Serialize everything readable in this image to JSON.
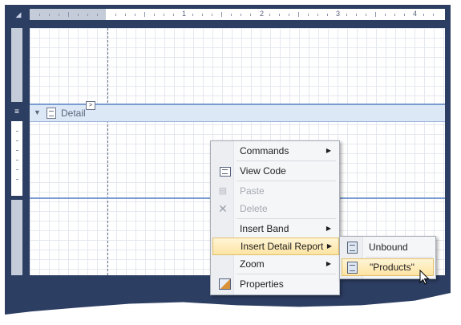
{
  "ruler": {
    "numbers": [
      "1",
      "2",
      "3",
      "4"
    ]
  },
  "band": {
    "label": "Detail",
    "smart_tag_glyph": ">"
  },
  "context_menu": {
    "items": [
      {
        "label": "Commands",
        "icon": "none",
        "submenu": true,
        "enabled": true
      },
      {
        "label": "View Code",
        "icon": "view-code-icon",
        "submenu": false,
        "enabled": true
      },
      {
        "label": "Paste",
        "icon": "paste-icon",
        "submenu": false,
        "enabled": false
      },
      {
        "label": "Delete",
        "icon": "delete-icon",
        "submenu": false,
        "enabled": false
      },
      {
        "label": "Insert Band",
        "icon": "none",
        "submenu": true,
        "enabled": true
      },
      {
        "label": "Insert Detail Report",
        "icon": "none",
        "submenu": true,
        "enabled": true,
        "highlighted": true
      },
      {
        "label": "Zoom",
        "icon": "none",
        "submenu": true,
        "enabled": true
      },
      {
        "label": "Properties",
        "icon": "properties-icon",
        "submenu": false,
        "enabled": true
      }
    ]
  },
  "submenu": {
    "items": [
      {
        "label": "Unbound",
        "icon": "report-icon"
      },
      {
        "label": "\"Products\"",
        "icon": "report-icon",
        "highlighted": true
      }
    ]
  },
  "colors": {
    "frame": "#2d3e63",
    "band_header": "#dde8f7",
    "highlight": "#fde4a3"
  }
}
